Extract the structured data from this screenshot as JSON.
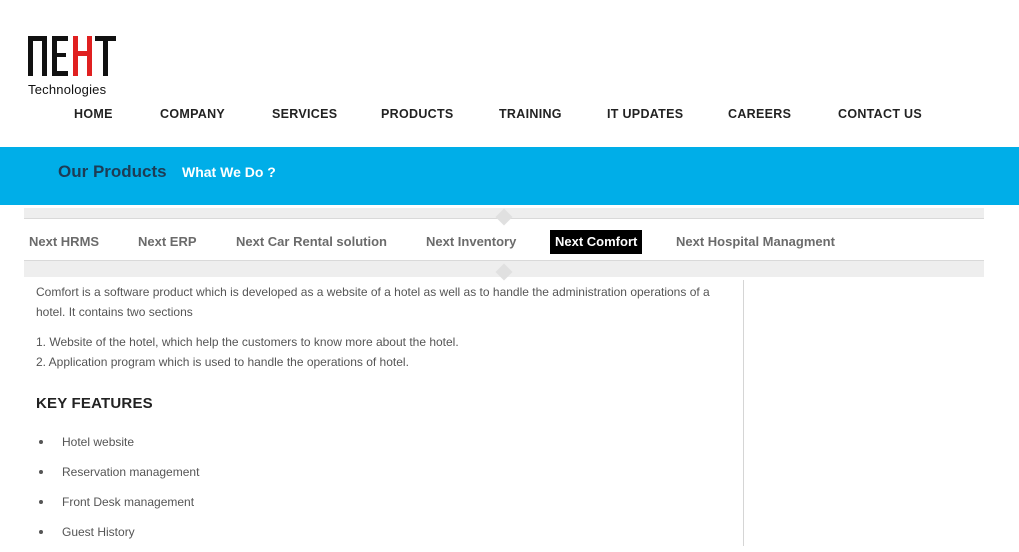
{
  "logo": {
    "wordmark": "NEXT",
    "tagline": "Technologies",
    "accent_color": "#e02020"
  },
  "nav": {
    "items": [
      {
        "label": "HOME"
      },
      {
        "label": "COMPANY"
      },
      {
        "label": "SERVICES"
      },
      {
        "label": "PRODUCTS"
      },
      {
        "label": "TRAINING"
      },
      {
        "label": "IT UPDATES"
      },
      {
        "label": "CAREERS"
      },
      {
        "label": "CONTACT US"
      }
    ]
  },
  "banner": {
    "title": "Our Products",
    "subtitle": "What We Do ?",
    "color": "#00aee8"
  },
  "tabs": [
    {
      "label": "Next HRMS",
      "active": false
    },
    {
      "label": "Next ERP",
      "active": false
    },
    {
      "label": "Next Car Rental solution",
      "active": false
    },
    {
      "label": "Next Inventory",
      "active": false
    },
    {
      "label": "Next Comfort",
      "active": true
    },
    {
      "label": "Next Hospital Managment",
      "active": false
    }
  ],
  "content": {
    "intro": "Comfort is a software product which is developed as a website of a hotel as well as to handle the administration operations of a hotel. It contains two sections",
    "sections": [
      "1. Website of the hotel, which help the customers to know more about the hotel.",
      "2. Application program which is used to handle the operations of hotel."
    ],
    "features_title": "KEY FEATURES",
    "features": [
      "Hotel website",
      "Reservation management",
      "Front Desk management",
      "Guest History"
    ]
  }
}
